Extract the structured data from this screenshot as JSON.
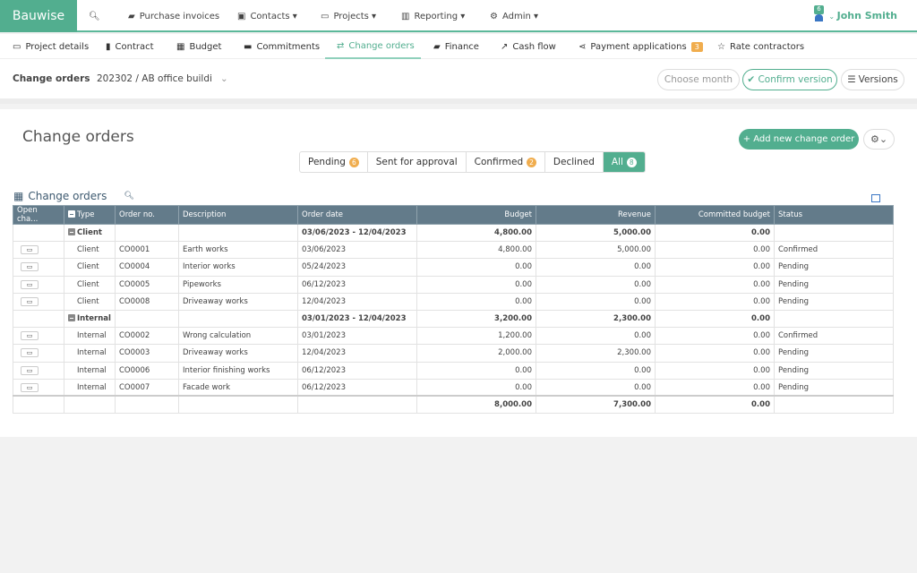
{
  "app": {
    "brand": "Bauwise",
    "user": "John Smith",
    "notification_count": "6"
  },
  "topnav": [
    {
      "icon": "book-icon",
      "label": "Purchase invoices"
    },
    {
      "icon": "contact-icon",
      "label": "Contacts ▾"
    },
    {
      "icon": "folder-icon",
      "label": "Projects ▾"
    },
    {
      "icon": "chart-icon",
      "label": "Reporting ▾"
    },
    {
      "icon": "gear-icon",
      "label": "Admin ▾"
    }
  ],
  "tabs": [
    {
      "label": "Project details",
      "icon": "monitor-icon"
    },
    {
      "label": "Contract",
      "icon": "bookmark-icon"
    },
    {
      "label": "Budget",
      "icon": "calculator-icon"
    },
    {
      "label": "Commitments",
      "icon": "archive-icon"
    },
    {
      "label": "Change orders",
      "icon": "retweet-icon",
      "active": true
    },
    {
      "label": "Finance",
      "icon": "book-icon"
    },
    {
      "label": "Cash flow",
      "icon": "line-chart-icon"
    },
    {
      "label": "Payment applications",
      "icon": "share-icon",
      "badge": "3"
    },
    {
      "label": "Rate contractors",
      "icon": "star-icon"
    }
  ],
  "toolbar": {
    "section": "Change orders",
    "project": "202302 / AB office buildi",
    "choose_month": "Choose month",
    "confirm": "✔ Confirm version",
    "versions": "Versions"
  },
  "page": {
    "title": "Change orders",
    "add_button": "+ Add new change order"
  },
  "filters": [
    {
      "label": "Pending",
      "count": "6"
    },
    {
      "label": "Sent for approval"
    },
    {
      "label": "Confirmed",
      "count": "2"
    },
    {
      "label": "Declined"
    },
    {
      "label": "All",
      "count": "8",
      "active": true
    }
  ],
  "grid": {
    "title": "Change orders",
    "columns": [
      "Open cha...",
      "Type",
      "Order no.",
      "Description",
      "Order date",
      "Budget",
      "Revenue",
      "Committed budget",
      "Status"
    ],
    "rows": [
      {
        "group": true,
        "type": "Client",
        "date": "03/06/2023 - 12/04/2023",
        "budget": "4,800.00",
        "revenue": "5,000.00",
        "committed": "0.00"
      },
      {
        "type": "Client",
        "no": "CO0001",
        "desc": "Earth works",
        "date": "03/06/2023",
        "budget": "4,800.00",
        "revenue": "5,000.00",
        "committed": "0.00",
        "status": "Confirmed"
      },
      {
        "type": "Client",
        "no": "CO0004",
        "desc": "Interior works",
        "date": "05/24/2023",
        "budget": "0.00",
        "revenue": "0.00",
        "committed": "0.00",
        "status": "Pending"
      },
      {
        "type": "Client",
        "no": "CO0005",
        "desc": "Pipeworks",
        "date": "06/12/2023",
        "budget": "0.00",
        "revenue": "0.00",
        "committed": "0.00",
        "status": "Pending"
      },
      {
        "type": "Client",
        "no": "CO0008",
        "desc": "Driveaway works",
        "date": "12/04/2023",
        "budget": "0.00",
        "revenue": "0.00",
        "committed": "0.00",
        "status": "Pending"
      },
      {
        "group": true,
        "type": "Internal",
        "date": "03/01/2023 - 12/04/2023",
        "budget": "3,200.00",
        "revenue": "2,300.00",
        "committed": "0.00"
      },
      {
        "type": "Internal",
        "no": "CO0002",
        "desc": "Wrong calculation",
        "date": "03/01/2023",
        "budget": "1,200.00",
        "revenue": "0.00",
        "committed": "0.00",
        "status": "Confirmed"
      },
      {
        "type": "Internal",
        "no": "CO0003",
        "desc": "Driveaway works",
        "date": "12/04/2023",
        "budget": "2,000.00",
        "revenue": "2,300.00",
        "committed": "0.00",
        "status": "Pending"
      },
      {
        "type": "Internal",
        "no": "CO0006",
        "desc": "Interior finishing works",
        "date": "06/12/2023",
        "budget": "0.00",
        "revenue": "0.00",
        "committed": "0.00",
        "status": "Pending"
      },
      {
        "type": "Internal",
        "no": "CO0007",
        "desc": "Facade work",
        "date": "06/12/2023",
        "budget": "0.00",
        "revenue": "0.00",
        "committed": "0.00",
        "status": "Pending"
      }
    ],
    "totals": {
      "budget": "8,000.00",
      "revenue": "7,300.00",
      "committed": "0.00"
    }
  },
  "colors": {
    "accent": "#52ae8f",
    "header": "#637b8a",
    "badge": "#f0ad4e"
  }
}
